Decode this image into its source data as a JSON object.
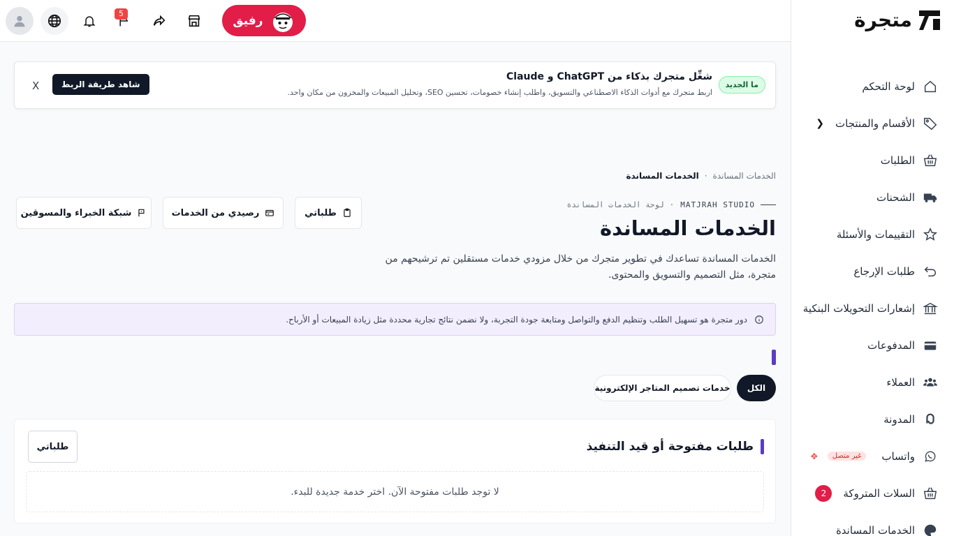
{
  "brand": {
    "name": "متجرة"
  },
  "sidebar": {
    "items": [
      {
        "label": "لوحة التحكم",
        "icon": "home-icon"
      },
      {
        "label": "الأقسام والمنتجات",
        "icon": "tag-icon"
      },
      {
        "label": "الطلبات",
        "icon": "basket-icon"
      },
      {
        "label": "الشحنات",
        "icon": "truck-icon"
      },
      {
        "label": "التقييمات والأسئلة",
        "icon": "star-icon"
      },
      {
        "label": "طلبات الإرجاع",
        "icon": "return-icon"
      },
      {
        "label": "إشعارات التحويلات البنكية",
        "icon": "bank-icon"
      },
      {
        "label": "المدفوعات",
        "icon": "card-icon"
      },
      {
        "label": "العملاء",
        "icon": "users-icon"
      },
      {
        "label": "المدونة",
        "icon": "blog-icon"
      },
      {
        "label": "واتساب",
        "icon": "whatsapp-icon",
        "status": "غير متصل"
      },
      {
        "label": "السلات المتروكة",
        "icon": "basket-icon",
        "count": "2"
      },
      {
        "label": "الخدمات المساندة",
        "icon": "palette-icon"
      }
    ]
  },
  "topbar": {
    "notifications_count": "5",
    "assistant_label": "رفيق"
  },
  "announcement": {
    "badge": "ما الجديد",
    "title": "شغِّل متجرك بذكاء من ChatGPT و Claude",
    "description": "اربط متجرك مع أدوات الذكاء الاصطناعي والتسويق، واطلب إنشاء خصومات، تحسين SEO، وتحليل المبيعات والمخزون من مكان واحد.",
    "cta": "شاهد طريقة الربط",
    "close": "X"
  },
  "breadcrumb": {
    "parent": "الخدمات المساندة",
    "separator": "·",
    "current": "الخدمات المساندة"
  },
  "header": {
    "kicker_brand": "MATJRAH STUDIO",
    "kicker_separator": "·",
    "kicker_sub": "لوحة الخدمات المساندة",
    "title": "الخدمات المساندة",
    "description": "الخدمات المساندة تساعدك في تطوير متجرك من خلال مزودي خدمات مستقلين تم ترشيحهم من متجرة، مثل التصميم والتسويق والمحتوى."
  },
  "quick_actions": {
    "my_requests": "طلباتي",
    "balance": "رصيدي من الخدمات",
    "experts": "شبكة الخبراء والمسوقين"
  },
  "notice": {
    "text": "دور متجرة هو تسهيل الطلب وتنظيم الدفع والتواصل ومتابعة جودة التجربة، ولا نضمن نتائج تجارية محددة مثل زيادة المبيعات أو الأرباح."
  },
  "filters": {
    "all": "الكل",
    "store_design": "خدمات تصميم المتاجر الإلكترونية"
  },
  "open_requests": {
    "title": "طلبات مفتوحة أو قيد التنفيذ",
    "button": "طلباتي",
    "empty": "لا توجد طلبات مفتوحة الآن. اختر خدمة جديدة للبدء."
  },
  "colors": {
    "brand_red": "#e11d48",
    "accent_purple": "#5b3cc4",
    "dark": "#111827",
    "notice_bg": "#f3eefe"
  }
}
